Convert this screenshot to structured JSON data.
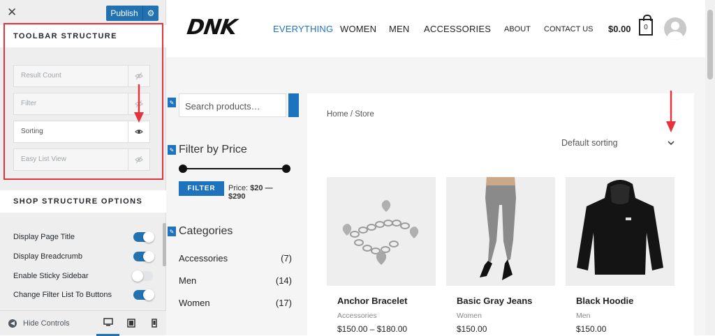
{
  "customizer": {
    "close_icon": "close-icon",
    "publish_label": "Publish",
    "toolbar_section_title": "TOOLBAR STRUCTURE",
    "toolbar_items": [
      {
        "label": "Result Count",
        "visible": false
      },
      {
        "label": "Filter",
        "visible": false
      },
      {
        "label": "Sorting",
        "visible": true
      },
      {
        "label": "Easy List View",
        "visible": false
      }
    ],
    "shop_section_title": "SHOP STRUCTURE OPTIONS",
    "options": [
      {
        "label": "Display Page Title",
        "on": true
      },
      {
        "label": "Display Breadcrumb",
        "on": true
      },
      {
        "label": "Enable Sticky Sidebar",
        "on": false
      },
      {
        "label": "Change Filter List To Buttons",
        "on": true
      }
    ],
    "hide_controls_label": "Hide Controls",
    "devices": [
      "desktop",
      "tablet",
      "mobile"
    ],
    "accent_color": "#2271b1",
    "highlight_color": "#e5323b"
  },
  "site": {
    "logo": "DNK",
    "nav_primary": [
      "EVERYTHING",
      "WOMEN",
      "MEN",
      "ACCESSORIES"
    ],
    "nav_secondary": [
      "ABOUT",
      "CONTACT US"
    ],
    "cart_total": "$0.00",
    "cart_count": "0",
    "search_placeholder": "Search products…",
    "filter_by_price_title": "Filter by Price",
    "filter_button": "FILTER",
    "price_label": "Price:",
    "price_range": "$20 — $290",
    "categories_title": "Categories",
    "categories": [
      {
        "name": "Accessories",
        "count": "(7)"
      },
      {
        "name": "Men",
        "count": "(14)"
      },
      {
        "name": "Women",
        "count": "(17)"
      }
    ],
    "breadcrumb": "Home / Store",
    "sorting_value": "Default sorting",
    "products": [
      {
        "name": "Anchor Bracelet",
        "category": "Accessories",
        "price": "$150.00 – $180.00"
      },
      {
        "name": "Basic Gray Jeans",
        "category": "Women",
        "price": "$150.00"
      },
      {
        "name": "Black Hoodie",
        "category": "Men",
        "price": "$150.00"
      }
    ],
    "accent_color": "#1e73be"
  }
}
